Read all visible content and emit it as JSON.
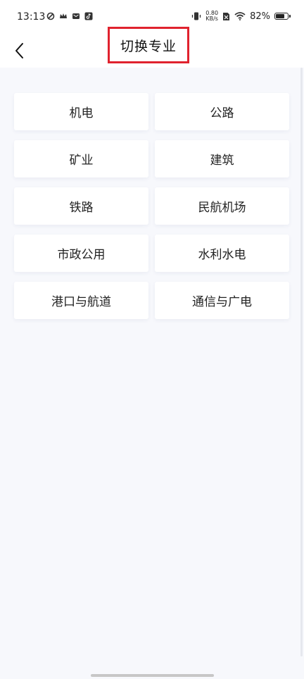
{
  "statusbar": {
    "time": "13:13",
    "net_speed_value": "0.80",
    "net_speed_unit": "KB/s",
    "battery_percent": "82%",
    "battery_level": 0.82
  },
  "header": {
    "title": "切换专业"
  },
  "majors": [
    {
      "label": "机电"
    },
    {
      "label": "公路"
    },
    {
      "label": "矿业"
    },
    {
      "label": "建筑"
    },
    {
      "label": "铁路"
    },
    {
      "label": "民航机场"
    },
    {
      "label": "市政公用"
    },
    {
      "label": "水利水电"
    },
    {
      "label": "港口与航道"
    },
    {
      "label": "通信与广电"
    }
  ],
  "icons": {
    "back": "chevron-left-icon",
    "wifi": "wifi-icon",
    "battery": "battery-icon"
  },
  "colors": {
    "highlight": "#e0222e",
    "background": "#f7f8fc",
    "card": "#ffffff"
  }
}
